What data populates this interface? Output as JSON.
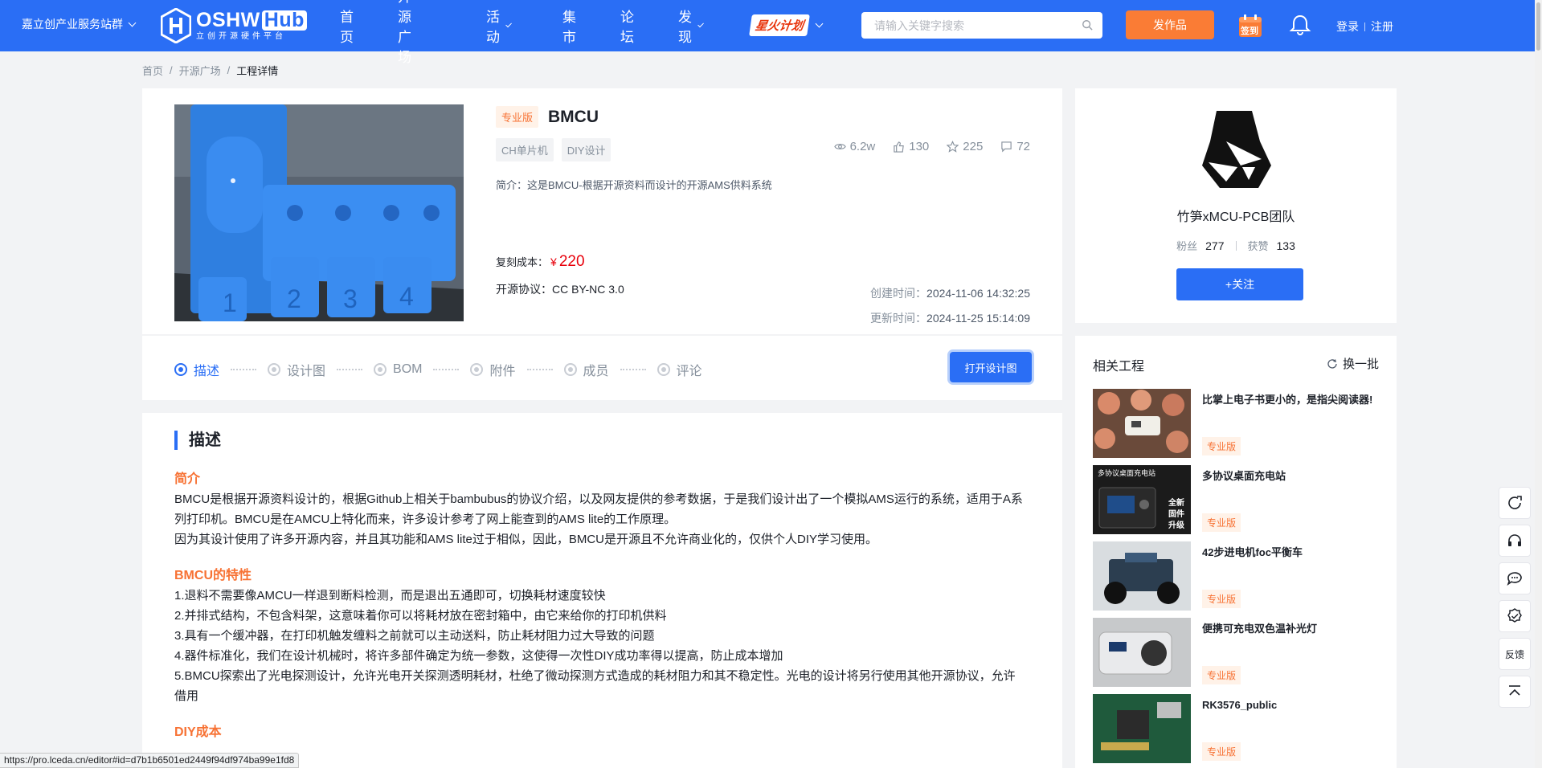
{
  "header": {
    "service_station": "嘉立创产业服务站群",
    "logo_text": "OSHW",
    "logo_hub": "Hub",
    "logo_sub": "立创开源硬件平台",
    "nav": [
      {
        "label": "首页",
        "dropdown": false
      },
      {
        "label": "开源广场",
        "dropdown": false
      },
      {
        "label": "活动",
        "dropdown": true
      },
      {
        "label": "集市",
        "dropdown": false
      },
      {
        "label": "论坛",
        "dropdown": false
      },
      {
        "label": "发现",
        "dropdown": true
      }
    ],
    "spark_plan": "星火计划",
    "search_placeholder": "请输入关键字搜索",
    "publish": "发作品",
    "checkin": "签到",
    "login": "登录",
    "register": "注册",
    "colors": {
      "primary": "#2a6ef5",
      "orange": "#fa7c35",
      "price": "#e8000b"
    }
  },
  "breadcrumb": [
    "首页",
    "开源广场",
    "工程详情"
  ],
  "project": {
    "edition_badge": "专业版",
    "title": "BMCU",
    "tags": [
      "CH单片机",
      "DIY设计"
    ],
    "stats": {
      "views": "6.2w",
      "likes": "130",
      "favorites": "225",
      "comments": "72"
    },
    "intro": "简介：这是BMCU-根据开源资料而设计的开源AMS供料系统",
    "cost_label": "复刻成本：",
    "currency": "¥",
    "cost": "220",
    "license": "开源协议：CC BY-NC 3.0",
    "created_label": "创建时间：",
    "created": "2024-11-06 14:32:25",
    "updated_label": "更新时间：",
    "updated": "2024-11-25 15:14:09"
  },
  "steps": [
    "描述",
    "设计图",
    "BOM",
    "附件",
    "成员",
    "评论"
  ],
  "open_design": "打开设计图",
  "description": {
    "heading": "描述",
    "sections": [
      {
        "title": "简介",
        "lines": [
          "BMCU是根据开源资料设计的，根据Github上相关于bambubus的协议介绍，以及网友提供的参考数据，于是我们设计出了一个模拟AMS运行的系统，适用于A系列打印机。BMCU是在AMCU上特化而来，许多设计参考了网上能查到的AMS lite的工作原理。",
          "因为其设计使用了许多开源内容，并且其功能和AMS lite过于相似，因此，BMCU是开源且不允许商业化的，仅供个人DIY学习使用。"
        ]
      },
      {
        "title": "BMCU的特性",
        "lines": [
          "1.退料不需要像AMCU一样退到断料检测，而是退出五通即可，切换耗材速度较快",
          "2.并排式结构，不包含料架，这意味着你可以将耗材放在密封箱中，由它来给你的打印机供料",
          "3.具有一个缓冲器，在打印机触发缠料之前就可以主动送料，防止耗材阻力过大导致的问题",
          "4.器件标准化，我们在设计机械时，将许多部件确定为统一参数，这使得一次性DIY成功率得以提高，防止成本增加",
          "5.BMCU探索出了光电探测设计，允许光电开关探测透明耗材，杜绝了微动探测方式造成的耗材阻力和其不稳定性。光电的设计将另行使用其他开源协议，允许借用"
        ]
      },
      {
        "title": "DIY成本",
        "lines": [
          "…………………………………………………………………………………………………………………………………………"
        ]
      }
    ]
  },
  "author": {
    "name": "竹笋xMCU-PCB团队",
    "fans_label": "粉丝",
    "fans": "277",
    "likes_label": "获赞",
    "likes": "133",
    "follow": "+关注"
  },
  "related": {
    "title": "相关工程",
    "refresh": "换一批",
    "items": [
      {
        "name": "比掌上电子书更小的，是指尖阅读器!",
        "badge": "专业版"
      },
      {
        "name": "多协议桌面充电站",
        "badge": "专业版",
        "thumb_text": [
          "多协议桌面充电站",
          "全新",
          "固件",
          "升级"
        ]
      },
      {
        "name": "42步进电机foc平衡车",
        "badge": "专业版"
      },
      {
        "name": "便携可充电双色温补光灯",
        "badge": "专业版"
      },
      {
        "name": "RK3576_public",
        "badge": "专业版"
      }
    ]
  },
  "float_tools": {
    "feedback": "反馈"
  },
  "status_url": "https://pro.lceda.cn/editor#id=d7b1b6501ed2449f94df974ba99e1fd8"
}
